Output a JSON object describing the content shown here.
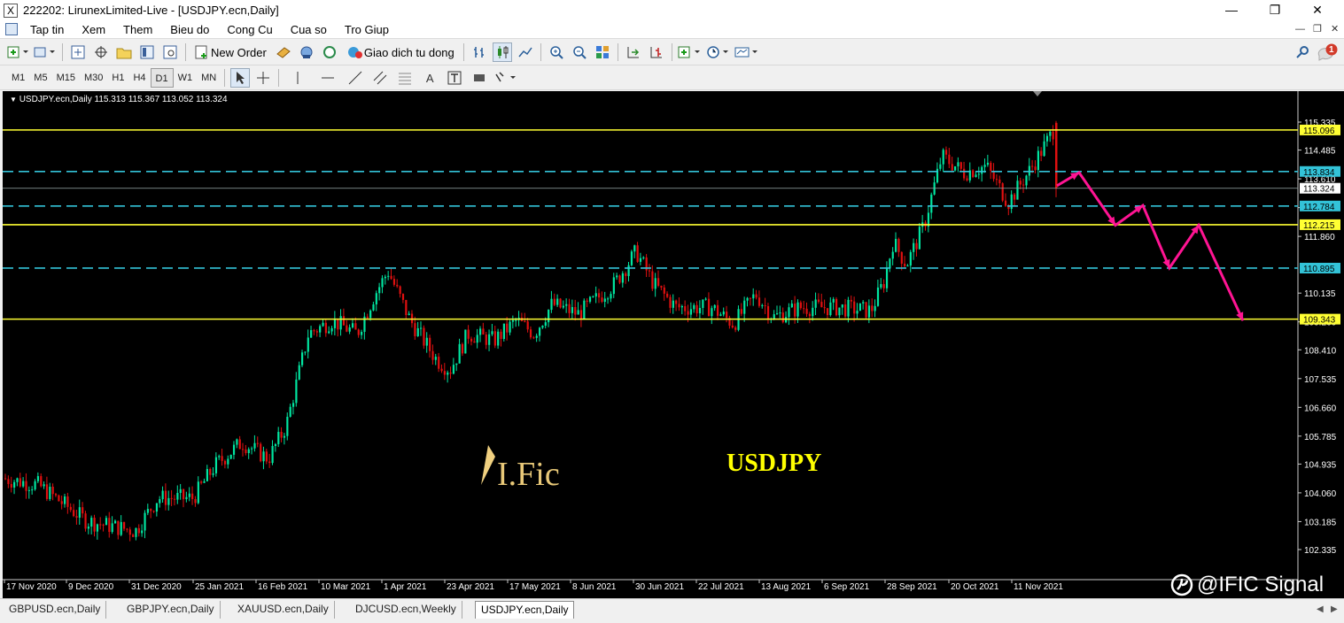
{
  "window": {
    "title": "222202: LirunexLimited-Live - [USDJPY.ecn,Daily]",
    "minimize": "—",
    "maximize": "❐",
    "close": "✕"
  },
  "menu": [
    "Tap tin",
    "Xem",
    "Them",
    "Bieu do",
    "Cong Cu",
    "Cua so",
    "Tro Giup"
  ],
  "toolbar": {
    "new_order": "New Order",
    "auto_trading": "Giao dich tu dong",
    "notifications_count": "1"
  },
  "timeframes": [
    "M1",
    "M5",
    "M15",
    "M30",
    "H1",
    "H4",
    "D1",
    "W1",
    "MN"
  ],
  "active_timeframe": "D1",
  "chart": {
    "header": "USDJPY.ecn,Daily  115.313 115.367 113.052 113.324",
    "symbol_label": "USDJPY",
    "logo_text": "I.Fic",
    "watermark": "@IFIC Signal",
    "bull_color": "#00e5a0",
    "bear_color": "#e01010",
    "level_color_yellow": "#ffff33",
    "level_color_cyan": "#33c3d8",
    "arrow_color": "#ff1493"
  },
  "price_axis": [
    "115.335",
    "114.485",
    "113.610",
    "112.735",
    "111.860",
    "110.135",
    "109.260",
    "108.410",
    "107.535",
    "106.660",
    "105.785",
    "104.935",
    "104.060",
    "103.185",
    "102.335"
  ],
  "price_labels": {
    "y115": "115.096",
    "c113": "113.834",
    "cur": "113.324",
    "c112": "112.784",
    "y112": "112.215",
    "c110": "110.895",
    "y109": "109.343"
  },
  "date_axis": [
    "17 Nov 2020",
    "9 Dec 2020",
    "31 Dec 2020",
    "25 Jan 2021",
    "16 Feb 2021",
    "10 Mar 2021",
    "1 Apr 2021",
    "23 Apr 2021",
    "17 May 2021",
    "8 Jun 2021",
    "30 Jun 2021",
    "22 Jul 2021",
    "13 Aug 2021",
    "6 Sep 2021",
    "28 Sep 2021",
    "20 Oct 2021",
    "11 Nov 2021"
  ],
  "tabs": [
    "GBPUSD.ecn,Daily",
    "GBPJPY.ecn,Daily",
    "XAUUSD.ecn,Daily",
    "DJCUSD.ecn,Weekly",
    "USDJPY.ecn,Daily"
  ],
  "active_tab": "USDJPY.ecn,Daily"
}
